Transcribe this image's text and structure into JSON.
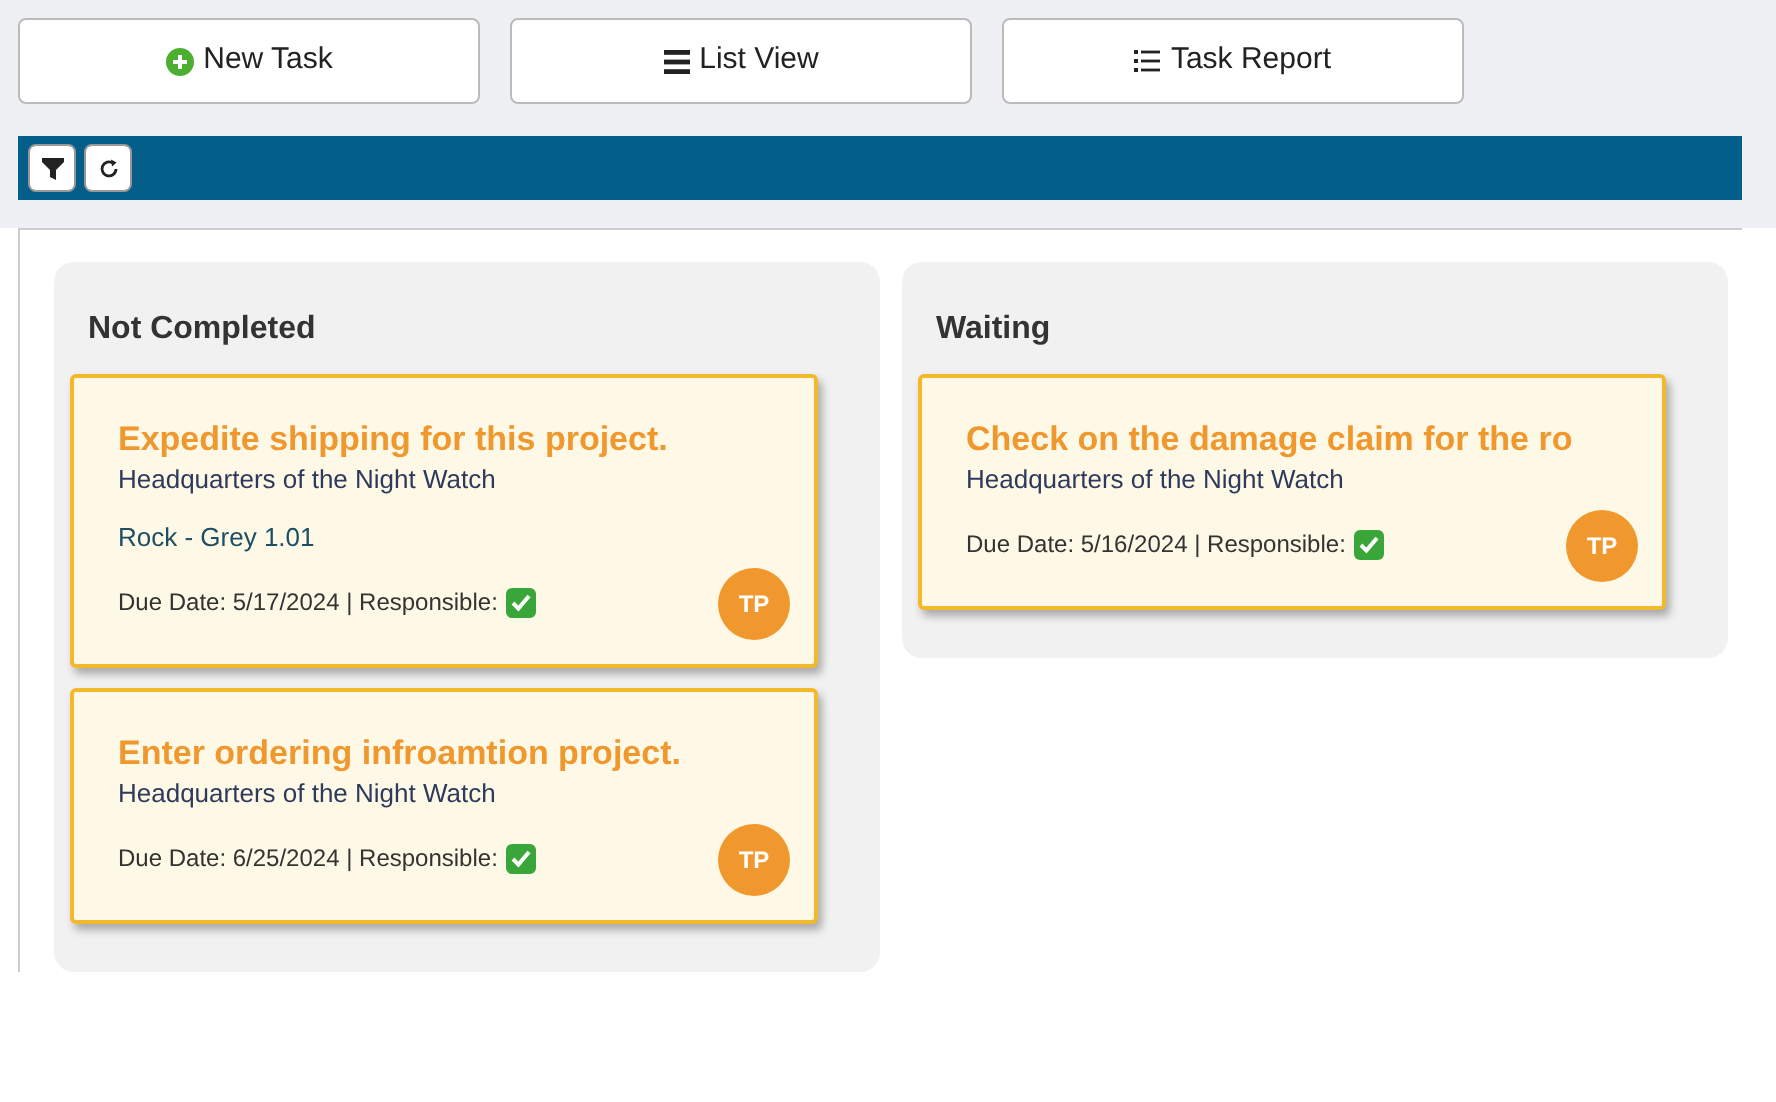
{
  "toolbar": {
    "buttons": [
      {
        "label": "New Task",
        "kind": "plus"
      },
      {
        "label": "List View",
        "kind": "bars"
      },
      {
        "label": "Task Report",
        "kind": "list"
      }
    ]
  },
  "filter_bar": {
    "buttons": [
      {
        "kind": "filter"
      },
      {
        "kind": "refresh"
      }
    ]
  },
  "columns": [
    {
      "title": "Not Completed",
      "cards": [
        {
          "title": "Expedite shipping for this project.",
          "location": "Headquarters of the Night Watch",
          "item": "Rock - Grey 1.01",
          "due": "Due Date: 5/17/2024 | Responsible:",
          "responsible_checked": true,
          "avatar": "TP"
        },
        {
          "title": "Enter ordering infroamtion project.",
          "location": "Headquarters of the Night Watch",
          "due": "Due Date: 6/25/2024 | Responsible:",
          "responsible_checked": true,
          "avatar": "TP"
        }
      ]
    },
    {
      "title": "Waiting",
      "cards": [
        {
          "title": "Check on the damage claim for the ro",
          "location": "Headquarters of the Night Watch",
          "due": "Due Date: 5/16/2024 | Responsible:",
          "responsible_checked": true,
          "avatar": "TP"
        }
      ]
    }
  ]
}
